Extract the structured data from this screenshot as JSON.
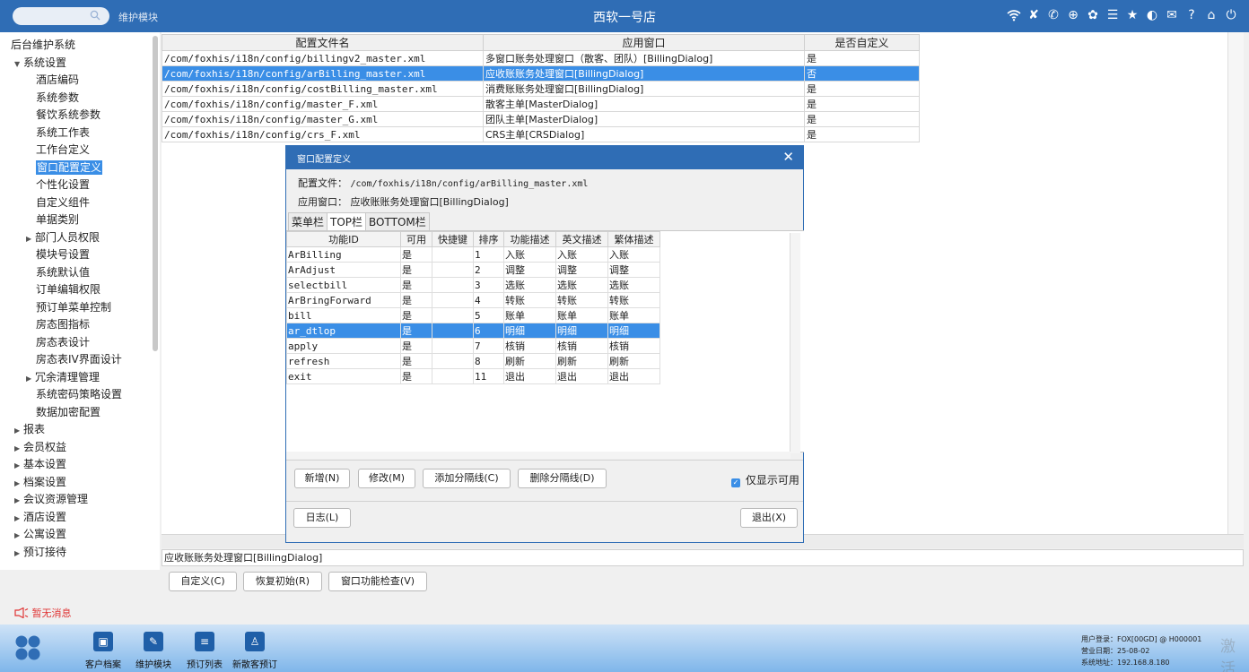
{
  "topbar": {
    "module_label": "维护模块",
    "store_title": "西软一号店",
    "icons": [
      "wifi-icon",
      "tools-icon",
      "phone-icon",
      "search-user-icon",
      "palette-icon",
      "menu-icon",
      "star-icon",
      "contrast-icon",
      "mail-icon",
      "help-icon",
      "home-icon",
      "power-icon"
    ]
  },
  "sidebar": {
    "items": [
      {
        "label": "后台维护系统",
        "level": 0,
        "arrow": ""
      },
      {
        "label": "系统设置",
        "level": 1,
        "arrow": "▼"
      },
      {
        "label": "酒店编码",
        "level": 2,
        "arrow": ""
      },
      {
        "label": "系统参数",
        "level": 2,
        "arrow": ""
      },
      {
        "label": "餐饮系统参数",
        "level": 2,
        "arrow": ""
      },
      {
        "label": "系统工作表",
        "level": 2,
        "arrow": ""
      },
      {
        "label": "工作台定义",
        "level": 2,
        "arrow": ""
      },
      {
        "label": "窗口配置定义",
        "level": 2,
        "arrow": "",
        "selected": true
      },
      {
        "label": "个性化设置",
        "level": 2,
        "arrow": ""
      },
      {
        "label": "自定义组件",
        "level": 2,
        "arrow": ""
      },
      {
        "label": "单据类别",
        "level": 2,
        "arrow": ""
      },
      {
        "label": "部门人员权限",
        "level": 2,
        "arrow": "▶"
      },
      {
        "label": "模块号设置",
        "level": 2,
        "arrow": ""
      },
      {
        "label": "系统默认值",
        "level": 2,
        "arrow": ""
      },
      {
        "label": "订单编辑权限",
        "level": 2,
        "arrow": ""
      },
      {
        "label": "预订单菜单控制",
        "level": 2,
        "arrow": ""
      },
      {
        "label": "房态图指标",
        "level": 2,
        "arrow": ""
      },
      {
        "label": "房态表设计",
        "level": 2,
        "arrow": ""
      },
      {
        "label": "房态表IV界面设计",
        "level": 2,
        "arrow": ""
      },
      {
        "label": "冗余清理管理",
        "level": 2,
        "arrow": "▶"
      },
      {
        "label": "系统密码策略设置",
        "level": 2,
        "arrow": ""
      },
      {
        "label": "数据加密配置",
        "level": 2,
        "arrow": ""
      },
      {
        "label": "报表",
        "level": 1,
        "arrow": "▶"
      },
      {
        "label": "会员权益",
        "level": 1,
        "arrow": "▶"
      },
      {
        "label": "基本设置",
        "level": 1,
        "arrow": "▶"
      },
      {
        "label": "档案设置",
        "level": 1,
        "arrow": "▶"
      },
      {
        "label": "会议资源管理",
        "level": 1,
        "arrow": "▶"
      },
      {
        "label": "酒店设置",
        "level": 1,
        "arrow": "▶"
      },
      {
        "label": "公寓设置",
        "level": 1,
        "arrow": "▶"
      },
      {
        "label": "预订接待",
        "level": 1,
        "arrow": "▶"
      }
    ],
    "search_placeholder": ""
  },
  "main_table": {
    "headers": [
      "配置文件名",
      "应用窗口",
      "是否自定义"
    ],
    "rows": [
      {
        "file": "/com/foxhis/i18n/config/billingv2_master.xml",
        "window": "多窗口账务处理窗口（散客、团队）[BillingDialog]",
        "custom": "是"
      },
      {
        "file": "/com/foxhis/i18n/config/arBilling_master.xml",
        "window": "应收账账务处理窗口[BillingDialog]",
        "custom": "否",
        "selected": true
      },
      {
        "file": "/com/foxhis/i18n/config/costBilling_master.xml",
        "window": "消费账账务处理窗口[BillingDialog]",
        "custom": "是"
      },
      {
        "file": "/com/foxhis/i18n/config/master_F.xml",
        "window": "散客主单[MasterDialog]",
        "custom": "是"
      },
      {
        "file": "/com/foxhis/i18n/config/master_G.xml",
        "window": "团队主单[MasterDialog]",
        "custom": "是"
      },
      {
        "file": "/com/foxhis/i18n/config/crs_F.xml",
        "window": "CRS主单[CRSDialog]",
        "custom": "是"
      }
    ]
  },
  "status_field": "应收账账务处理窗口[BillingDialog]",
  "bottom_buttons": {
    "customize": "自定义(C)",
    "restore": "恢复初始(R)",
    "check": "窗口功能检查(V)"
  },
  "notice": "暂无消息",
  "dialog": {
    "title": "窗口配置定义",
    "config_file_label": "配置文件：",
    "config_file_value": "/com/foxhis/i18n/config/arBilling_master.xml",
    "app_window_label": "应用窗口：",
    "app_window_value": "应收账账务处理窗口[BillingDialog]",
    "tabs": [
      "菜单栏",
      "TOP栏",
      "BOTTOM栏"
    ],
    "active_tab": 1,
    "grid_headers": [
      "功能ID",
      "可用",
      "快捷键",
      "排序",
      "功能描述",
      "英文描述",
      "繁体描述"
    ],
    "grid_rows": [
      {
        "id": "ArBilling",
        "enabled": "是",
        "hotkey": "",
        "order": "1",
        "desc": "入账",
        "en": "入账",
        "tw": "入账"
      },
      {
        "id": "ArAdjust",
        "enabled": "是",
        "hotkey": "",
        "order": "2",
        "desc": "调整",
        "en": "调整",
        "tw": "调整"
      },
      {
        "id": "selectbill",
        "enabled": "是",
        "hotkey": "",
        "order": "3",
        "desc": "选账",
        "en": "选账",
        "tw": "选账"
      },
      {
        "id": "ArBringForward",
        "enabled": "是",
        "hotkey": "",
        "order": "4",
        "desc": "转账",
        "en": "转账",
        "tw": "转账"
      },
      {
        "id": "bill",
        "enabled": "是",
        "hotkey": "",
        "order": "5",
        "desc": "账单",
        "en": "账单",
        "tw": "账单"
      },
      {
        "id": "ar_dtlop",
        "enabled": "是",
        "hotkey": "",
        "order": "6",
        "desc": "明细",
        "en": "明细",
        "tw": "明细",
        "selected": true
      },
      {
        "id": "apply",
        "enabled": "是",
        "hotkey": "",
        "order": "7",
        "desc": "核销",
        "en": "核销",
        "tw": "核销"
      },
      {
        "id": "refresh",
        "enabled": "是",
        "hotkey": "",
        "order": "8",
        "desc": "刷新",
        "en": "刷新",
        "tw": "刷新"
      },
      {
        "id": "exit",
        "enabled": "是",
        "hotkey": "",
        "order": "11",
        "desc": "退出",
        "en": "退出",
        "tw": "退出"
      }
    ],
    "buttons": {
      "add": "新增(N)",
      "modify": "修改(M)",
      "add_separator": "添加分隔线(C)",
      "delete_separator": "删除分隔线(D)",
      "log": "日志(L)",
      "exit": "退出(X)"
    },
    "only_visible_label": "仅显示可用",
    "only_visible_checked": true
  },
  "dock": {
    "items": [
      {
        "label": "客户档案",
        "icon": "customer-file-icon"
      },
      {
        "label": "维护模块",
        "icon": "wrench-icon"
      },
      {
        "label": "预订列表",
        "icon": "list-icon"
      },
      {
        "label": "新散客预订",
        "icon": "new-guest-icon"
      }
    ],
    "user_login": "用户登录：FOX[00GD] @ H000001",
    "business_date": "营业日期：25-08-02",
    "system_address": "系统地址：192.168.8.180",
    "watermark": "激活"
  },
  "colors": {
    "primary": "#2f6db5",
    "selection": "#3a8ee6",
    "notice_red": "#e03434"
  }
}
